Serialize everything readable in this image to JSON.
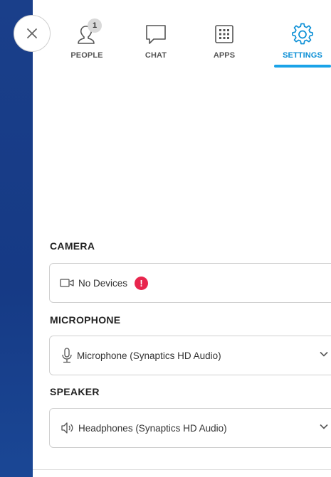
{
  "tabs": [
    {
      "label": "PEOPLE",
      "badge": "1",
      "icon": "people-icon"
    },
    {
      "label": "CHAT",
      "icon": "chat-icon"
    },
    {
      "label": "APPS",
      "icon": "apps-icon"
    },
    {
      "label": "SETTINGS",
      "icon": "gear-icon",
      "active": true
    }
  ],
  "camera": {
    "title": "CAMERA",
    "value": "No Devices",
    "icon": "camera-icon",
    "warning": "!"
  },
  "microphone": {
    "title": "MICROPHONE",
    "value": "Microphone (Synaptics HD Audio)",
    "icon": "microphone-icon"
  },
  "speaker": {
    "title": "SPEAKER",
    "value": "Headphones (Synaptics HD Audio)",
    "icon": "speaker-icon"
  },
  "colors": {
    "accent": "#1aa3e8",
    "active_label": "#0b8fd6",
    "sidebar": "#1a3f8a",
    "warning": "#e8254d"
  }
}
